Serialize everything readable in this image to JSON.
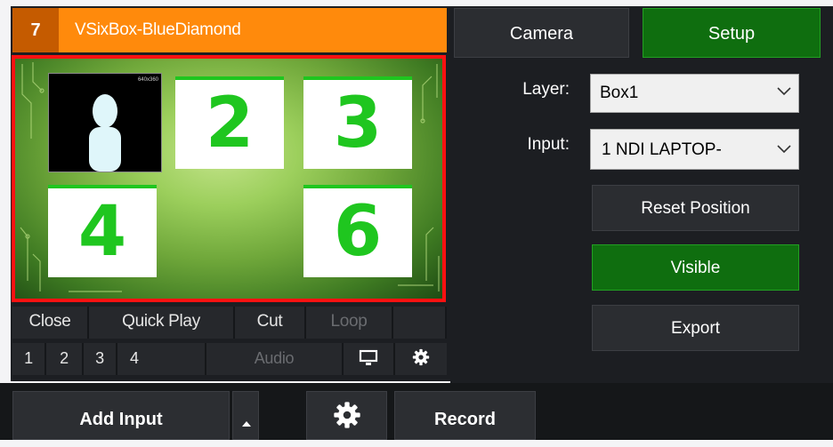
{
  "input_panel": {
    "number": "7",
    "title": "VSixBox-BlueDiamond",
    "preview": {
      "tiles": [
        "2",
        "3",
        "4",
        "6"
      ],
      "camera_tag": "640x360"
    },
    "row1_buttons": [
      "Close",
      "Quick Play",
      "Cut",
      "Loop"
    ],
    "row2_buttons": [
      "1",
      "2",
      "3",
      "4",
      "Audio"
    ],
    "icons": [
      "monitor-icon",
      "gear-icon"
    ]
  },
  "settings_panel": {
    "tabs": {
      "camera": "Camera",
      "setup": "Setup"
    },
    "layer": {
      "label": "Layer:",
      "value": "Box1"
    },
    "input": {
      "label": "Input:",
      "value": "1 NDI LAPTOP-"
    },
    "buttons": {
      "reset": "Reset Position",
      "visible": "Visible",
      "export": "Export"
    }
  },
  "bottom_bar": {
    "add_input": "Add Input",
    "record": "Record",
    "icons": [
      "caret-up-icon",
      "gear-icon"
    ]
  },
  "colors": {
    "accent_orange": "#ff8a0c",
    "active_green": "#0f6e0f",
    "tile_green": "#1fc61f",
    "selection_red": "#ff1111",
    "panel_bg": "#1c1e22"
  }
}
